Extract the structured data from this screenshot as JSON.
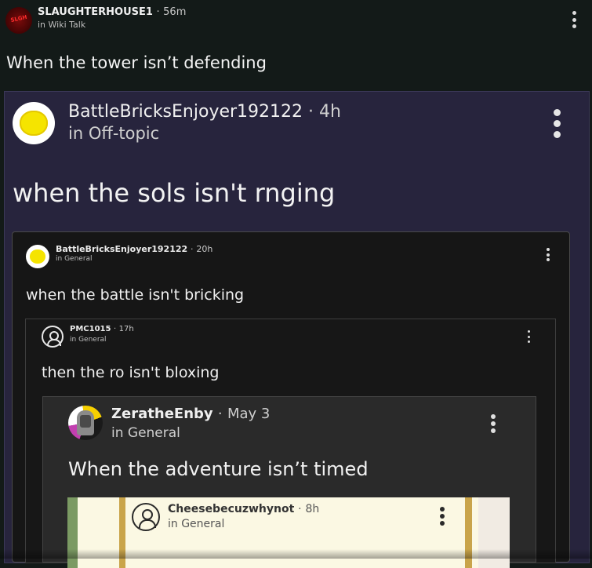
{
  "post": {
    "username": "SLAUGHTERHOUSE1",
    "separator": "·",
    "time": "56m",
    "location": "in Wiki Talk",
    "title": "When the tower isn’t defending",
    "avatar_text": "SLGH"
  },
  "quote1": {
    "username": "BattleBricksEnjoyer192122",
    "separator": "·",
    "time": "4h",
    "location": "in Off-topic",
    "title": "when the sols isn't rnging"
  },
  "quote2": {
    "username": "BattleBricksEnjoyer192122",
    "separator": "·",
    "time": "20h",
    "location": "in General",
    "title": "when the battle isn't bricking"
  },
  "quote3": {
    "username": "PMC1015",
    "separator": "·",
    "time": "17h",
    "location": "in General",
    "title": "then the ro isn't bloxing"
  },
  "quote4": {
    "username": "ZeratheEnby",
    "separator": "·",
    "time": "May 3",
    "location": "in General",
    "title": "When the adventure isn’t timed"
  },
  "quote5": {
    "username": "Cheesebecuzwhynot",
    "separator": "·",
    "time": "8h",
    "location": "in General"
  },
  "icons": {
    "menu": "vertical-ellipsis",
    "default_avatar": "user-outline-avatar"
  },
  "colors": {
    "page_bg": "#131a18",
    "quote1_bg": "#27243d",
    "quote2_bg": "#161616",
    "quote4_bg": "#2a2a2a",
    "quote5_bg": "#fbf8e3"
  }
}
